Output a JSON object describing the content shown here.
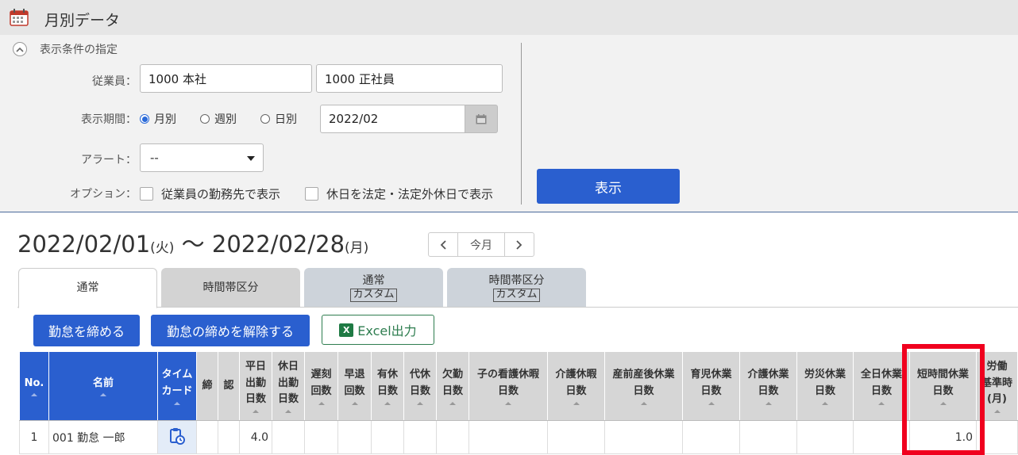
{
  "header": {
    "title": "月別データ"
  },
  "filter": {
    "section_label": "表示条件の指定",
    "employee_label": "従業員：",
    "employee_value1": "1000 本社",
    "employee_value2": "1000 正社員",
    "period_label": "表示期間：",
    "period_options": [
      "月別",
      "週別",
      "日別"
    ],
    "period_selected": "月別",
    "month_value": "2022/02",
    "alert_label": "アラート：",
    "alert_value": "--",
    "option_label": "オプション：",
    "option1": "従業員の勤務先で表示",
    "option2": "休日を法定・法定外休日で表示",
    "show_button": "表示"
  },
  "range": {
    "start": "2022/02/01",
    "start_dow": "(火)",
    "sep": "〜",
    "end": "2022/02/28",
    "end_dow": "(月)",
    "today": "今月"
  },
  "tabs": [
    {
      "label": "通常",
      "sub": ""
    },
    {
      "label": "時間帯区分",
      "sub": ""
    },
    {
      "label": "通常",
      "sub": "カスタム"
    },
    {
      "label": "時間帯区分",
      "sub": "カスタム"
    }
  ],
  "actions": {
    "close": "勤怠を締める",
    "unclose": "勤怠の締めを解除する",
    "excel": "Excel出力",
    "excel_icon": "X"
  },
  "table": {
    "headers": [
      "No.",
      "名前",
      "タイム\nカード",
      "締",
      "認",
      "平日\n出勤\n日数",
      "休日\n出勤\n日数",
      "遅刻\n回数",
      "早退\n回数",
      "有休\n日数",
      "代休\n日数",
      "欠勤\n日数",
      "子の看護休暇\n日数",
      "介護休暇\n日数",
      "産前産後休業\n日数",
      "育児休業\n日数",
      "介護休業\n日数",
      "労災休業\n日数",
      "全日休業\n日数",
      "短時間休業\n日数",
      "労働\n基準時\n(月)"
    ],
    "rows": [
      {
        "no": "1",
        "name": "001 勤怠 一郎",
        "weekday_days": "4.0",
        "short_time_leave": "1.0"
      }
    ]
  }
}
